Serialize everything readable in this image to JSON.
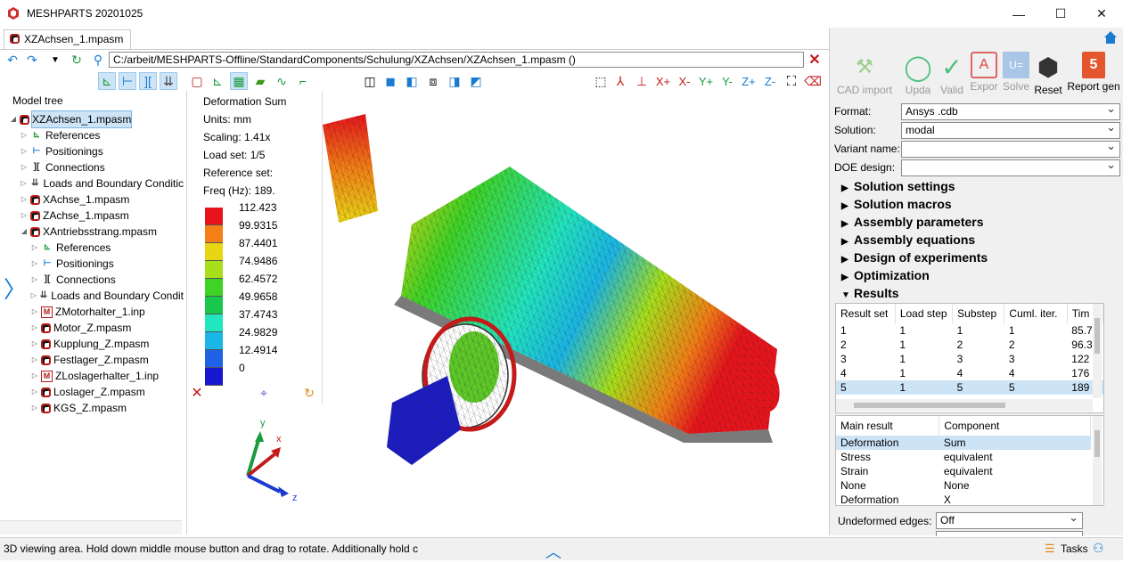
{
  "window": {
    "title": "MESHPARTS 20201025",
    "minimize": "—",
    "maximize": "☐",
    "close": "✕"
  },
  "tabs": [
    {
      "label": "XZAchsen_1.mpasm"
    }
  ],
  "path": {
    "value": "C:/arbeit/MESHPARTS-Offline/StandardComponents/Schulung/XZAchsen/XZAchsen_1.mpasm ()"
  },
  "tree": {
    "header": "Model tree",
    "items": [
      {
        "label": "XZAchsen_1.mpasm",
        "icon": "assembly-icon",
        "level": 0,
        "arrow": "▲"
      },
      {
        "label": "References",
        "icon": "references-icon",
        "level": 1,
        "arrow": "▷"
      },
      {
        "label": "Positionings",
        "icon": "positionings-icon",
        "level": 1,
        "arrow": "▷"
      },
      {
        "label": "Connections",
        "icon": "connections-icon",
        "level": 1,
        "arrow": "▷"
      },
      {
        "label": "Loads and Boundary Conditic",
        "icon": "loads-icon",
        "level": 1,
        "arrow": "▷"
      },
      {
        "label": "XAchse_1.mpasm",
        "icon": "assembly-icon",
        "level": 1,
        "arrow": "▷"
      },
      {
        "label": "ZAchse_1.mpasm",
        "icon": "assembly-icon",
        "level": 1,
        "arrow": "▷"
      },
      {
        "label": "XAntriebsstrang.mpasm",
        "icon": "assembly-icon",
        "level": 1,
        "arrow": "▲"
      },
      {
        "label": "References",
        "icon": "references-icon",
        "level": 2,
        "arrow": "▷"
      },
      {
        "label": "Positionings",
        "icon": "positionings-icon",
        "level": 2,
        "arrow": "▷"
      },
      {
        "label": "Connections",
        "icon": "connections-icon",
        "level": 2,
        "arrow": "▷"
      },
      {
        "label": "Loads and Boundary Condit",
        "icon": "loads-icon",
        "level": 2,
        "arrow": "▷"
      },
      {
        "label": "ZMotorhalter_1.inp",
        "icon": "mesh-icon",
        "level": 2,
        "arrow": "▷"
      },
      {
        "label": "Motor_Z.mpasm",
        "icon": "assembly-icon",
        "level": 2,
        "arrow": "▷"
      },
      {
        "label": "Kupplung_Z.mpasm",
        "icon": "assembly-icon",
        "level": 2,
        "arrow": "▷"
      },
      {
        "label": "Festlager_Z.mpasm",
        "icon": "assembly-icon",
        "level": 2,
        "arrow": "▷"
      },
      {
        "label": "ZLoslagerhalter_1.inp",
        "icon": "mesh-icon",
        "level": 2,
        "arrow": "▷"
      },
      {
        "label": "Loslager_Z.mpasm",
        "icon": "assembly-icon",
        "level": 2,
        "arrow": "▷"
      },
      {
        "label": "KGS_Z.mpasm",
        "icon": "assembly-icon",
        "level": 2,
        "arrow": "▷"
      }
    ]
  },
  "legend": {
    "title": "Deformation Sum",
    "units": "Units: mm",
    "scaling": "Scaling: 1.41x",
    "loadset": "Load set: 1/5",
    "refset": "Reference set:",
    "freq": "Freq (Hz): 189.",
    "values": [
      "112.423",
      "99.9315",
      "87.4401",
      "74.9486",
      "62.4572",
      "49.9658",
      "37.4743",
      "24.9829",
      "12.4914",
      "0"
    ],
    "colors": [
      "#e8141b",
      "#f37f16",
      "#e8d615",
      "#a7e01a",
      "#3fd425",
      "#19c74d",
      "#21e6bf",
      "#1ab6e6",
      "#1f62e8",
      "#1717d2"
    ]
  },
  "toolbar": {
    "cad_import": "CAD import",
    "update": "Upda",
    "validate": "Valid",
    "export": "Expor",
    "solve": "Solve",
    "reset": "Reset",
    "report": "Report gen"
  },
  "form": {
    "format_label": "Format:",
    "format_value": "Ansys .cdb",
    "solution_label": "Solution:",
    "solution_value": "modal",
    "variant_label": "Variant name:",
    "variant_value": "",
    "doe_label": "DOE design:",
    "doe_value": ""
  },
  "sections": [
    {
      "label": "Solution settings",
      "expanded": false
    },
    {
      "label": "Solution macros",
      "expanded": false
    },
    {
      "label": "Assembly parameters",
      "expanded": false
    },
    {
      "label": "Assembly equations",
      "expanded": false
    },
    {
      "label": "Design of experiments",
      "expanded": false
    },
    {
      "label": "Optimization",
      "expanded": false
    },
    {
      "label": "Results",
      "expanded": true
    }
  ],
  "results_table": {
    "headers": [
      "Result set",
      "Load step",
      "Substep",
      "Cuml. iter.",
      "Tim"
    ],
    "rows": [
      [
        "1",
        "1",
        "1",
        "1",
        "85.7"
      ],
      [
        "2",
        "1",
        "2",
        "2",
        "96.3"
      ],
      [
        "3",
        "1",
        "3",
        "3",
        "122"
      ],
      [
        "4",
        "1",
        "4",
        "4",
        "176"
      ],
      [
        "5",
        "1",
        "5",
        "5",
        "189"
      ]
    ],
    "selected_row": 4
  },
  "main_result_table": {
    "headers": [
      "Main result",
      "Component"
    ],
    "rows": [
      [
        "Deformation",
        "Sum"
      ],
      [
        "Stress",
        "equivalent"
      ],
      [
        "Strain",
        "equivalent"
      ],
      [
        "None",
        "None"
      ],
      [
        "Deformation",
        "X"
      ]
    ],
    "selected_row": 0
  },
  "undeformed": {
    "label": "Undeformed edges:",
    "value": "Off"
  },
  "status": {
    "text": "3D viewing area. Hold down middle mouse button and drag to rotate. Additionally hold c",
    "tasks": "Tasks"
  }
}
